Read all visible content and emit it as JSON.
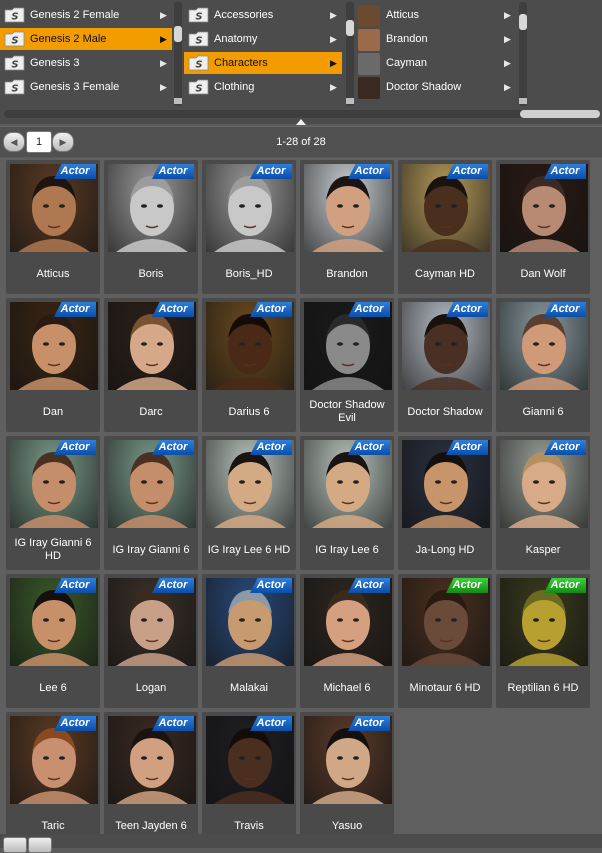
{
  "browser": {
    "col1": [
      {
        "label": "Genesis 2 Female",
        "selected": false
      },
      {
        "label": "Genesis 2 Male",
        "selected": true
      },
      {
        "label": "Genesis 3",
        "selected": false
      },
      {
        "label": "Genesis 3 Female",
        "selected": false
      }
    ],
    "col2": [
      {
        "label": "Accessories",
        "selected": false
      },
      {
        "label": "Anatomy",
        "selected": false
      },
      {
        "label": "Characters",
        "selected": true
      },
      {
        "label": "Clothing",
        "selected": false
      }
    ],
    "col3": [
      {
        "label": "Atticus",
        "color": "#6b4a30"
      },
      {
        "label": "Brandon",
        "color": "#9a6a4a"
      },
      {
        "label": "Cayman",
        "color": "#6a6a6a"
      },
      {
        "label": "Doctor Shadow",
        "color": "#3a2a22"
      }
    ]
  },
  "nav": {
    "page": "1",
    "count": "1-28 of 28",
    "prev_icon": "arrow-left-icon",
    "next_icon": "arrow-right-icon"
  },
  "tiles": [
    {
      "name": "Atticus",
      "badge": "Actor",
      "badge_color": "blue",
      "bg": "#5a3a24",
      "skin": "#b07850",
      "hair": "#1e1410"
    },
    {
      "name": "Boris",
      "badge": "Actor",
      "badge_color": "blue",
      "bg": "#9a9a9a",
      "skin": "#c8c8c8",
      "hair": "#9c9c9c"
    },
    {
      "name": "Boris_HD",
      "badge": "Actor",
      "badge_color": "blue",
      "bg": "#9a9a9a",
      "skin": "#c8c8c8",
      "hair": "#9c9c9c"
    },
    {
      "name": "Brandon",
      "badge": "Actor",
      "badge_color": "blue",
      "bg": "#c8cfd4",
      "skin": "#d0a080",
      "hair": "#1a1412"
    },
    {
      "name": "Cayman HD",
      "badge": "Actor",
      "badge_color": "blue",
      "bg": "#b59a5a",
      "skin": "#4a2e1e",
      "hair": "#1a120e"
    },
    {
      "name": "Dan Wolf",
      "badge": "Actor",
      "badge_color": "blue",
      "bg": "#2a1a14",
      "skin": "#b88a74",
      "hair": "#3a2a22"
    },
    {
      "name": "Dan",
      "badge": "Actor",
      "badge_color": "blue",
      "bg": "#3a2614",
      "skin": "#c89068",
      "hair": "#2a1a12"
    },
    {
      "name": "Darc",
      "badge": "Actor",
      "badge_color": "blue",
      "bg": "#2c2018",
      "skin": "#d4a888",
      "hair": "#7a5230"
    },
    {
      "name": "Darius 6",
      "badge": "Actor",
      "badge_color": "blue",
      "bg": "#6a4a1e",
      "skin": "#4a2a16",
      "hair": "#140c08"
    },
    {
      "name": "Doctor Shadow Evil",
      "badge": "Actor",
      "badge_color": "blue",
      "bg": "#1a1a1a",
      "skin": "#8a8a8a",
      "hair": "#2a2a2a"
    },
    {
      "name": "Doctor Shadow",
      "badge": "Actor",
      "badge_color": "blue",
      "bg": "#b4bcc4",
      "skin": "#4a3024",
      "hair": "#1a100c"
    },
    {
      "name": "Gianni 6",
      "badge": "Actor",
      "badge_color": "blue",
      "bg": "#8a9aa0",
      "skin": "#d09a78",
      "hair": "#5a4030"
    },
    {
      "name": "IG Iray Gianni 6 HD",
      "badge": "Actor",
      "badge_color": "blue",
      "bg": "#7a9a8a",
      "skin": "#c48e6a",
      "hair": "#4a3020"
    },
    {
      "name": "IG Iray Gianni 6",
      "badge": "Actor",
      "badge_color": "blue",
      "bg": "#7a9a8a",
      "skin": "#c48e6a",
      "hair": "#4a3020"
    },
    {
      "name": "IG Iray Lee 6 HD",
      "badge": "Actor",
      "badge_color": "blue",
      "bg": "#b8c4bc",
      "skin": "#d4aa84",
      "hair": "#1a1410"
    },
    {
      "name": "IG Iray Lee 6",
      "badge": "Actor",
      "badge_color": "blue",
      "bg": "#b8c4bc",
      "skin": "#d4aa84",
      "hair": "#1a1410"
    },
    {
      "name": "Ja-Long HD",
      "badge": "Actor",
      "badge_color": "blue",
      "bg": "#2a3040",
      "skin": "#c8946a",
      "hair": "#141010"
    },
    {
      "name": "Kasper",
      "badge": "Actor",
      "badge_color": "blue",
      "bg": "#9aa09a",
      "skin": "#d8aa88",
      "hair": "#b49060"
    },
    {
      "name": "Lee 6",
      "badge": "Actor",
      "badge_color": "blue",
      "bg": "#3a5a2a",
      "skin": "#c89068",
      "hair": "#141010"
    },
    {
      "name": "Logan",
      "badge": "Actor",
      "badge_color": "blue",
      "bg": "#3a3028",
      "skin": "#c8a088",
      "hair": "#3a2a1e"
    },
    {
      "name": "Malakai",
      "badge": "Actor",
      "badge_color": "blue",
      "bg": "#2a4a7a",
      "skin": "#c89a70",
      "hair": "#8a9aa8"
    },
    {
      "name": "Michael 6",
      "badge": "Actor",
      "badge_color": "blue",
      "bg": "#2e2620",
      "skin": "#d4a080",
      "hair": "#3a2a1c"
    },
    {
      "name": "Minotaur 6 HD",
      "badge": "Actor",
      "badge_color": "green",
      "bg": "#4a3020",
      "skin": "#6a4a38",
      "hair": "#2a1a12"
    },
    {
      "name": "Reptilian 6 HD",
      "badge": "Actor",
      "badge_color": "green",
      "bg": "#3a3a1e",
      "skin": "#b8a030",
      "hair": "#6a6a20"
    },
    {
      "name": "Taric",
      "badge": "Actor",
      "badge_color": "blue",
      "bg": "#5a3a24",
      "skin": "#c89070",
      "hair": "#8a4a20"
    },
    {
      "name": "Teen Jayden 6",
      "badge": "Actor",
      "badge_color": "blue",
      "bg": "#3a2a22",
      "skin": "#d0a080",
      "hair": "#1a1410"
    },
    {
      "name": "Travis",
      "badge": "Actor",
      "badge_color": "blue",
      "bg": "#1e1e24",
      "skin": "#4a2e20",
      "hair": "#140c08"
    },
    {
      "name": "Yasuo",
      "badge": "Actor",
      "badge_color": "blue",
      "bg": "#5a3a2a",
      "skin": "#d0a888",
      "hair": "#141010"
    }
  ]
}
